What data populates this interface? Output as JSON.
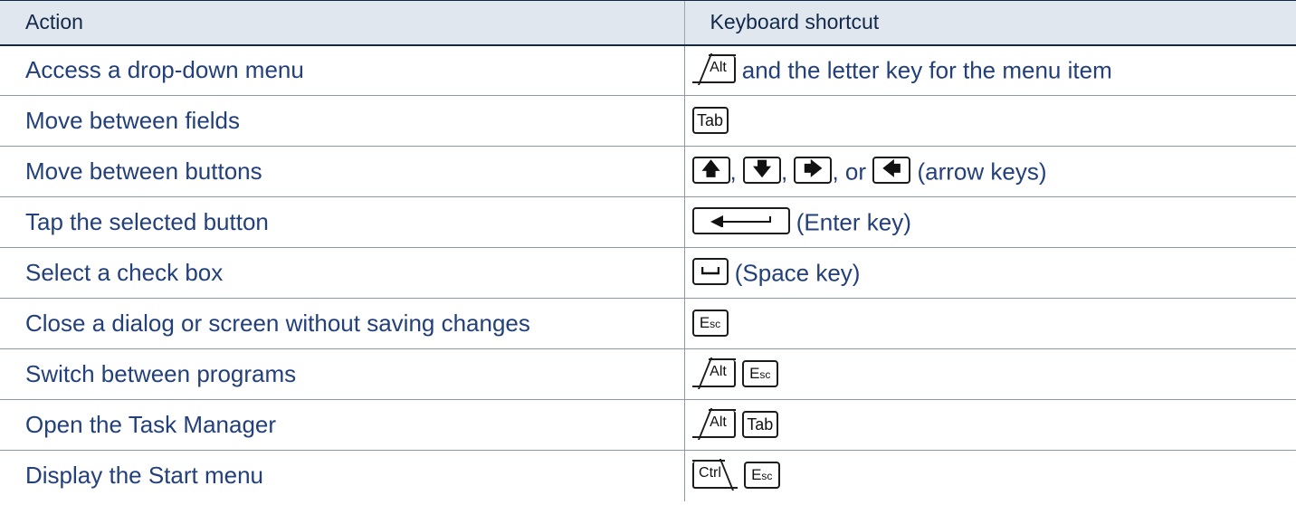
{
  "header": {
    "action": "Action",
    "shortcut": "Keyboard shortcut"
  },
  "rows": [
    {
      "action": "Access a drop-down menu",
      "after": "and the letter key for the menu item"
    },
    {
      "action": "Move between fields"
    },
    {
      "action": "Move between buttons",
      "after": "(arrow keys)",
      "or": "or"
    },
    {
      "action": "Tap the selected button",
      "after": "(Enter key)"
    },
    {
      "action": "Select a check box",
      "after": "(Space key)"
    },
    {
      "action": "Close a dialog or screen without saving changes"
    },
    {
      "action": "Switch between programs"
    },
    {
      "action": "Open the Task Manager"
    },
    {
      "action": "Display the Start menu"
    }
  ],
  "keys": {
    "alt": "Alt",
    "ctrl": "Ctrl",
    "tab": "Tab",
    "esc_e": "E",
    "esc_sc": "sc",
    "up": "🡅",
    "down": "🡇",
    "right": "🡆",
    "left": "🡄",
    "comma": ","
  }
}
